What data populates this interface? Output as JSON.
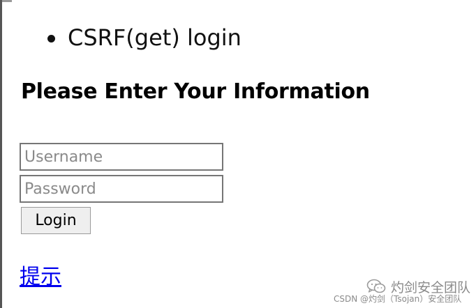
{
  "breadcrumb": {
    "item": "CSRF(get) login"
  },
  "form": {
    "heading": "Please Enter Your Information",
    "username_placeholder": "Username",
    "password_placeholder": "Password",
    "login_label": "Login"
  },
  "hint_link": "提示",
  "watermark": {
    "logo_icon": "wechat-icon",
    "title": "灼剑安全团队",
    "credit": "CSDN @灼剑（Tsojan）安全团队"
  }
}
